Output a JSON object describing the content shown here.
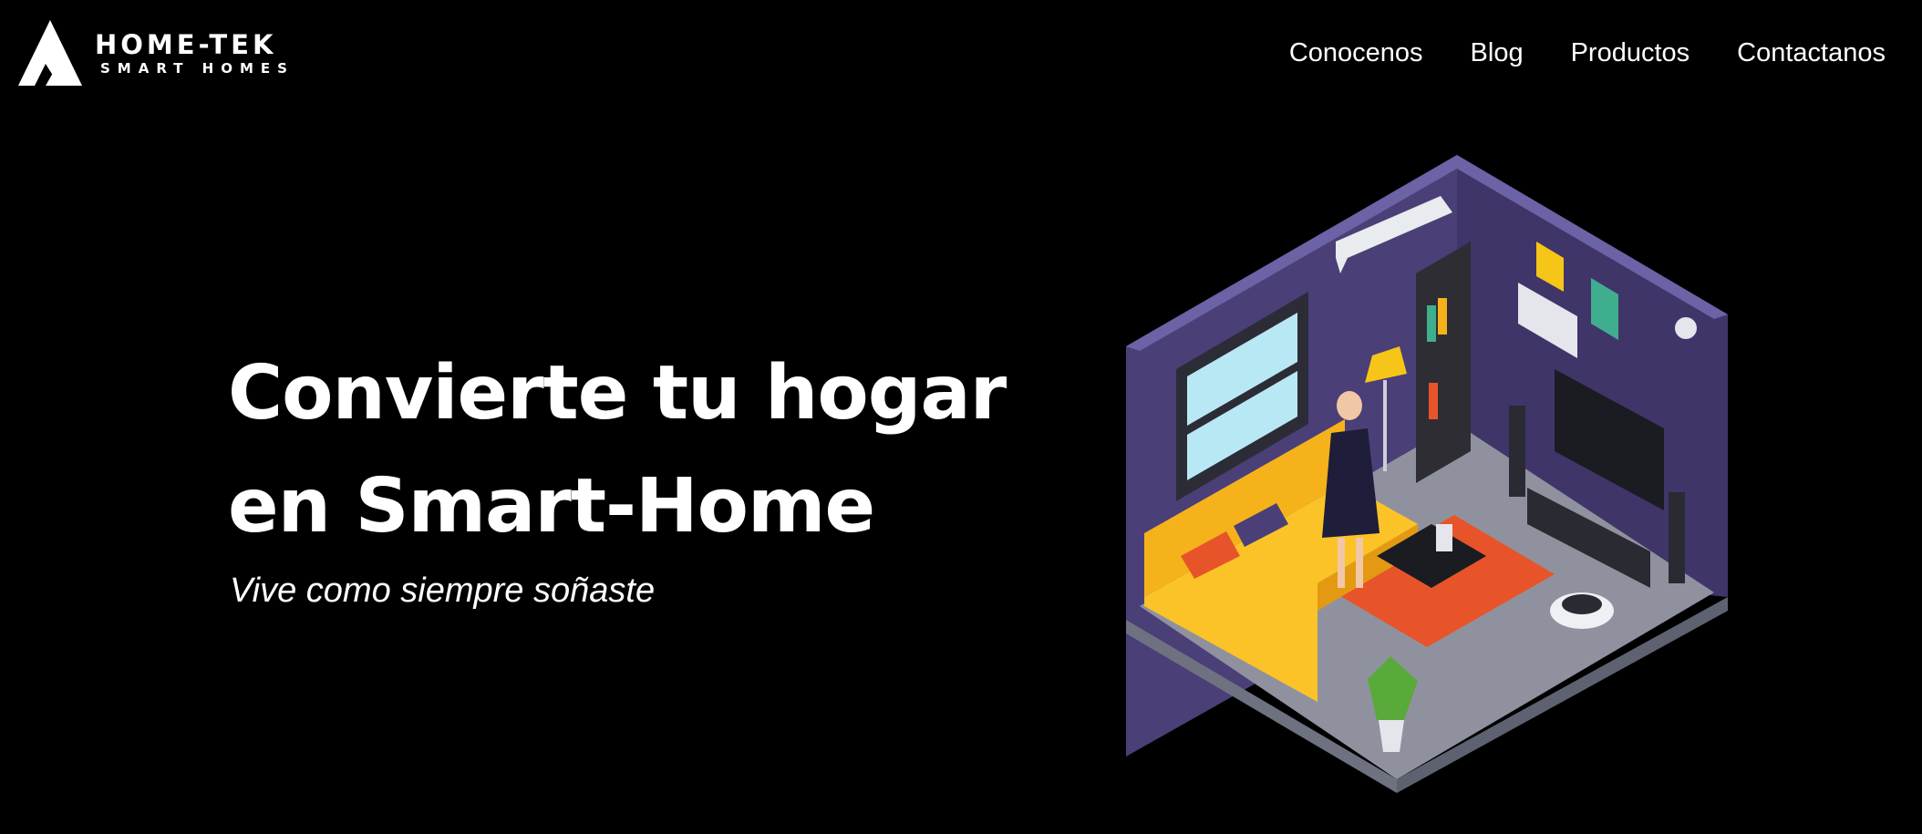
{
  "brand": {
    "name": "HOME-TEK",
    "tagline": "SMART HOMES",
    "logo_icon": "triangle-logo-icon"
  },
  "nav": {
    "items": [
      {
        "label": "Conocenos"
      },
      {
        "label": "Blog"
      },
      {
        "label": "Productos"
      },
      {
        "label": "Contactanos"
      }
    ]
  },
  "hero": {
    "title_line1": "Convierte tu hogar",
    "title_line2": "en Smart-Home",
    "subtitle": "Vive como siempre soñaste",
    "illustration": "isometric-smart-living-room"
  },
  "colors": {
    "background": "#000000",
    "text": "#ffffff",
    "wall": "#4b3f78",
    "floor": "#8f929e",
    "sofa": "#f5b21a",
    "rug": "#e8542a"
  }
}
